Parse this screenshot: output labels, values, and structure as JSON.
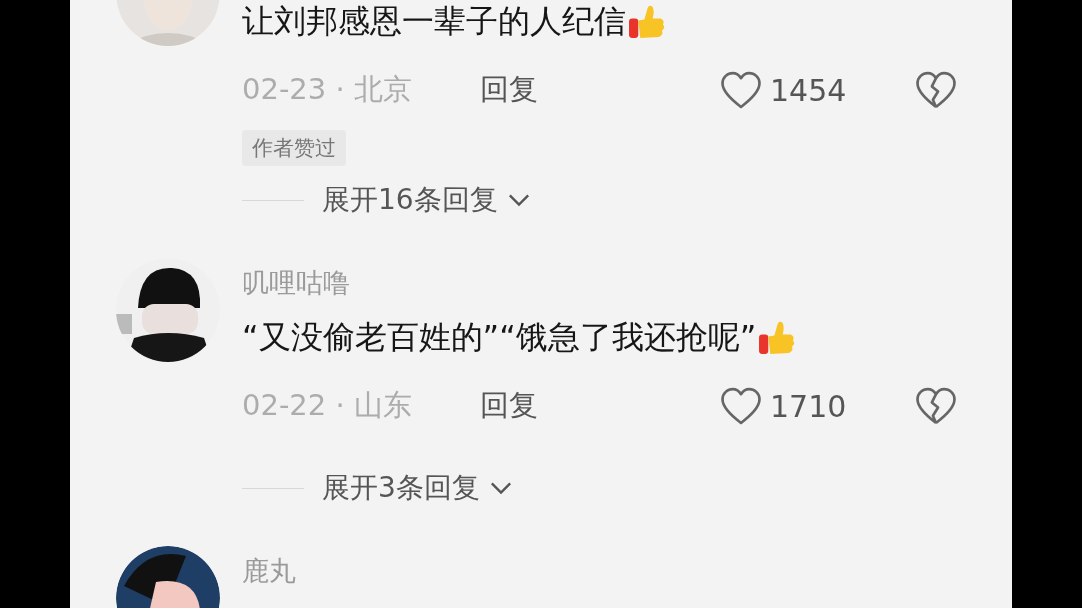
{
  "comments": [
    {
      "text": "让刘邦感恩一辈子的人纪信",
      "meta": "02-23 · 北京",
      "reply": "回复",
      "likes": "1454",
      "badge": "作者赞过",
      "expand": "展开16条回复"
    },
    {
      "name": "叽哩咕噜",
      "text": "“又没偷老百姓的”“饿急了我还抢呢”",
      "meta": "02-22 · 山东",
      "reply": "回复",
      "likes": "1710",
      "expand": "展开3条回复"
    },
    {
      "name": "鹿丸"
    }
  ]
}
